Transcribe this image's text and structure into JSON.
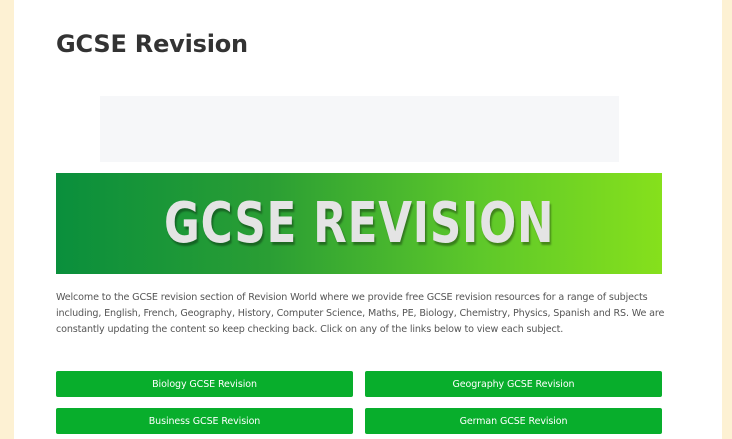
{
  "page": {
    "title": "GCSE Revision",
    "banner_text": "GCSE REVISION",
    "intro": "Welcome to the GCSE revision section of Revision World where we provide free GCSE revision resources for a range of subjects including, English, French, Geography, History, Computer Science, Maths, PE, Biology, Chemistry, Physics, Spanish and RS. We are constantly updating the content so keep checking back. Click on any of the links below to view each subject."
  },
  "subjects": [
    {
      "label": "Biology GCSE Revision"
    },
    {
      "label": "Geography GCSE Revision"
    },
    {
      "label": "Business GCSE Revision"
    },
    {
      "label": "German GCSE Revision"
    }
  ],
  "colors": {
    "background": "#fdf1d3",
    "button": "#08ae2c",
    "banner_start": "#0a8f3c",
    "banner_end": "#86e01c"
  }
}
